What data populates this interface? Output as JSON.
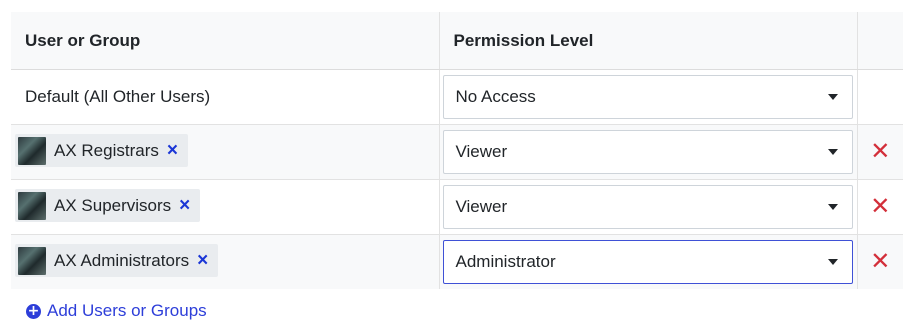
{
  "table": {
    "headers": {
      "user_or_group": "User or Group",
      "permission_level": "Permission Level"
    },
    "default_row": {
      "label": "Default (All Other Users)",
      "permission": "No Access"
    },
    "rows": [
      {
        "name": "AX Registrars",
        "permission": "Viewer",
        "remove_icon": "×",
        "delete_icon": "✕"
      },
      {
        "name": "AX Supervisors",
        "permission": "Viewer",
        "remove_icon": "×",
        "delete_icon": "✕"
      },
      {
        "name": "AX Administrators",
        "permission": "Administrator",
        "remove_icon": "×",
        "delete_icon": "✕"
      }
    ]
  },
  "add_link": {
    "label": "Add Users or Groups",
    "icon": "plus-circle-icon"
  },
  "colors": {
    "link_blue": "#2d3ed9",
    "chip_x_blue": "#1a36d6",
    "delete_red": "#d32f3a",
    "focus_border": "#3f51d6"
  }
}
